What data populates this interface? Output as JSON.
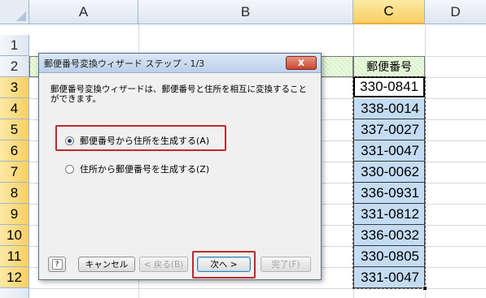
{
  "spreadsheet": {
    "columns": [
      "A",
      "B",
      "C",
      "D"
    ],
    "rows": [
      "1",
      "2",
      "3",
      "4",
      "5",
      "6",
      "7",
      "8",
      "9",
      "10",
      "11",
      "12"
    ],
    "header_c": "郵便番号",
    "postal_codes": [
      "330-0841",
      "338-0014",
      "337-0027",
      "331-0047",
      "330-0062",
      "336-0931",
      "331-0812",
      "336-0032",
      "330-0805",
      "331-0047"
    ]
  },
  "dialog": {
    "title": "郵便番号変換ウィザード ステップ - 1/3",
    "close": "x",
    "description": "郵便番号変換ウィザードは、郵便番号と住所を相互に変換することができます。",
    "options": [
      {
        "label": "郵便番号から住所を生成する(A)",
        "selected": true
      },
      {
        "label": "住所から郵便番号を生成する(Z)",
        "selected": false
      }
    ],
    "help": "?",
    "buttons": {
      "cancel": "キャンセル",
      "back": "< 戻る(B)",
      "next": "次へ >",
      "finish": "完了(F)"
    }
  },
  "colors": {
    "selection_blue": "#c4dcf3",
    "highlight_red": "#c0282d",
    "header_green": "#d8f2c7"
  }
}
